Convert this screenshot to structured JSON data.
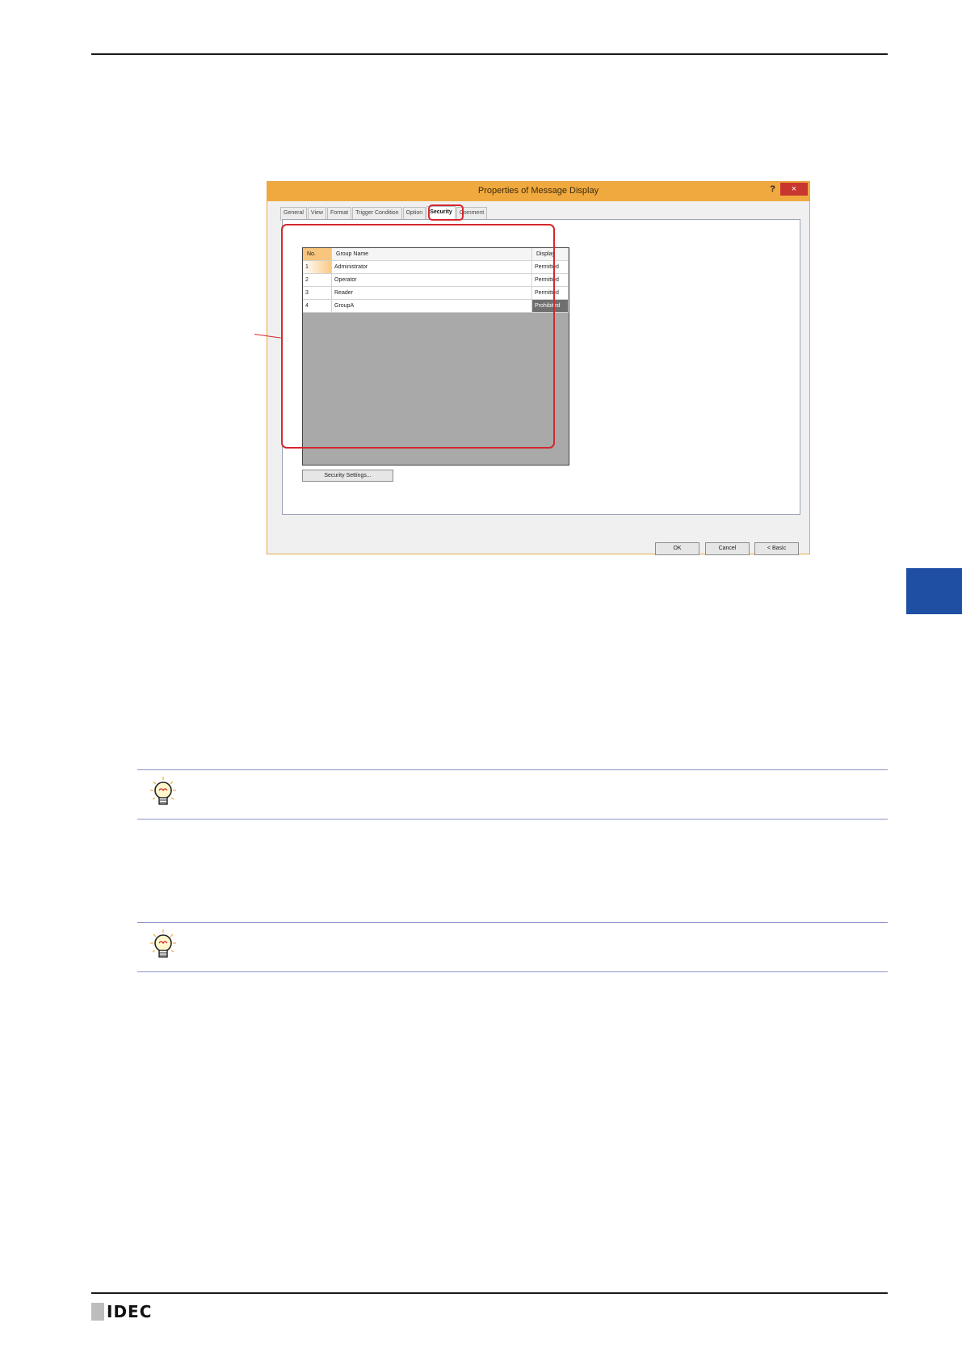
{
  "dialog": {
    "title": "Properties of Message Display",
    "help_label": "?",
    "close_label": "×",
    "tabs": [
      {
        "label": "General",
        "active": false
      },
      {
        "label": "View",
        "active": false
      },
      {
        "label": "Format",
        "active": false
      },
      {
        "label": "Trigger Condition",
        "active": false
      },
      {
        "label": "Option",
        "active": false
      },
      {
        "label": "Security",
        "active": true
      },
      {
        "label": "Comment",
        "active": false
      }
    ],
    "table": {
      "headers": {
        "no": "No.",
        "group_name": "Group Name",
        "display": "Display"
      },
      "rows": [
        {
          "no": "1",
          "group_name": "Administrator",
          "display": "Permitted"
        },
        {
          "no": "2",
          "group_name": "Operator",
          "display": "Permitted"
        },
        {
          "no": "3",
          "group_name": "Reader",
          "display": "Permitted"
        },
        {
          "no": "4",
          "group_name": "GroupA",
          "display": "Prohibited"
        }
      ]
    },
    "security_settings_button": "Security Settings...",
    "ok_button": "OK",
    "cancel_button": "Cancel",
    "basic_button": "< Basic"
  },
  "footer": {
    "brand": "IDEC"
  },
  "colors": {
    "title_bar": "#f0a93e",
    "highlight": "#d6262e",
    "side_tab": "#1e4fa3",
    "hint_rule": "#8c93c9"
  }
}
